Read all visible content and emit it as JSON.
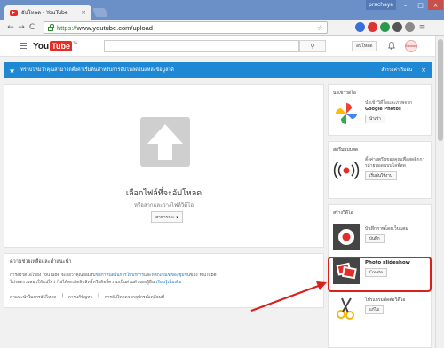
{
  "browser": {
    "tab_title": "อัปโหลด - YouTube",
    "tab_close": "×",
    "user_badge": "prachaya",
    "win_min": "–",
    "win_max": "□",
    "win_close": "×",
    "back": "←",
    "forward": "→",
    "reload": "C",
    "url_scheme": "https://",
    "url_rest": "www.youtube.com/upload",
    "star_glyph": "☆"
  },
  "header": {
    "logo_you": "You",
    "logo_tube": "Tube",
    "logo_tm": "TH",
    "upload_label": "อัปโหลด",
    "bell_glyph": "🔔",
    "avatar_text": "Stewart",
    "search_glyph": "⚲"
  },
  "banner": {
    "star": "★",
    "message": "ทราบไหมว่าคุณสามารถตั้งค่าเริ่มต้นสำหรับการอัปโหลดในแหล่งข้อมูลได้",
    "link": "สำรวจค่าเริ่มต้น",
    "close": "×"
  },
  "upload": {
    "title": "เลือกไฟล์ที่จะอัปโหลด",
    "subtitle": "หรือลากและวางไฟล์วิดีโอ",
    "privacy": "สาธารณะ ▾"
  },
  "help": {
    "title": "ความช่วยเหลือและคำแนะนำ",
    "text_prefix": "การส่งวิดีโอไปยัง YouTube จะถือว่าคุณยอมรับ",
    "text_link1": "ข้อกำหนดในการให้บริการ",
    "text_mid": "และ",
    "text_link2": "หลักเกณฑ์ของชุมชน",
    "text_suffix": "ของ YouTube",
    "text_line2": "โปรดตรวจสอบให้แน่ใจว่าไม่ได้ละเมิดลิขสิทธิ์หรือสิทธิ์ความเป็นส่วนตัวของผู้อื่น",
    "text_link3": "เรียนรู้เพิ่มเติม",
    "links": [
      "คำแนะนำในการอัปโหลด",
      "การแก้ปัญหา",
      "การอัปโหลดจากอุปกรณ์เคลื่อนที่"
    ],
    "sep": "|"
  },
  "import_card": {
    "title": "นำเข้าวิดีโอ",
    "text_line1": "นำเข้าวิดีโอและภาพจาก",
    "text_bold": "Google Photos",
    "button": "นำเข้า"
  },
  "live_card": {
    "title": "สตรีมแบบสด",
    "text": "ตั้งค่าสตรีมของคุณเพื่อสดตีกการถ่ายทอดแบบไลฟ์สด",
    "button": "เริ่มต้นใช้งาน"
  },
  "create_card": {
    "title": "สร้างวิดีโอ",
    "items": [
      {
        "label": "บันทึกภาพโดยเว็บแคม",
        "button": "บันทึก"
      },
      {
        "label": "Photo slideshow",
        "button": "Create"
      },
      {
        "label": "โปรแกรมตัดต่อวิดีโอ",
        "button": "แก้ไข"
      }
    ]
  },
  "colors": {
    "banner": "#1e88d4",
    "youtube_red": "#e52d27",
    "highlight": "#d9201b"
  }
}
